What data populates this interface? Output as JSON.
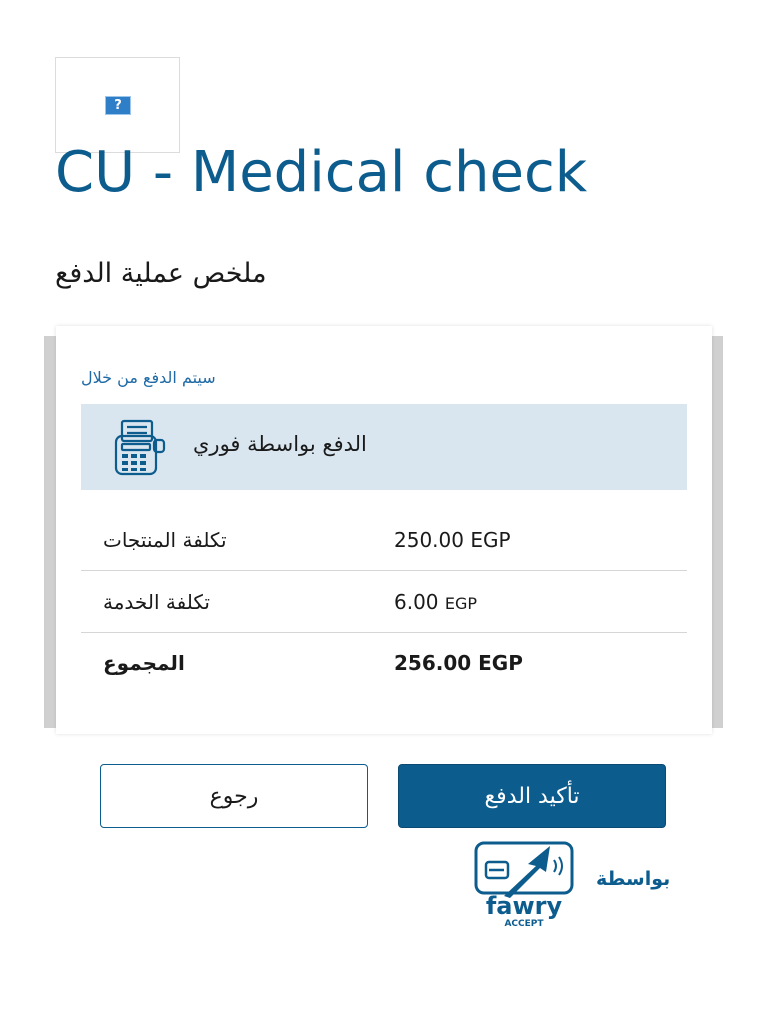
{
  "app": {
    "title": "CU - Medical check",
    "subtitle": "ملخص عملية الدفع",
    "logo_placeholder": "?"
  },
  "payment": {
    "via_label": "سيتم الدفع من خلال",
    "method_label": "الدفع بواسطة فوري",
    "method_icon": "pos-terminal-icon"
  },
  "summary": {
    "rows": [
      {
        "label": "تكلفة المنتجات",
        "value": "250.00 EGP"
      },
      {
        "label": "تكلفة الخدمة",
        "value": "6.00",
        "currency": "EGP"
      },
      {
        "label": "المجموع",
        "value": "256.00 EGP"
      }
    ]
  },
  "actions": {
    "back_label": "رجوع",
    "confirm_label": "تأكيد الدفع"
  },
  "footer": {
    "by_label": "بواسطة",
    "brand_name": "fawry",
    "brand_sub": "ACCEPT"
  },
  "colors": {
    "primary": "#0d5c8e",
    "method_bg": "#d9e5ef",
    "link": "#1f6aa5"
  }
}
